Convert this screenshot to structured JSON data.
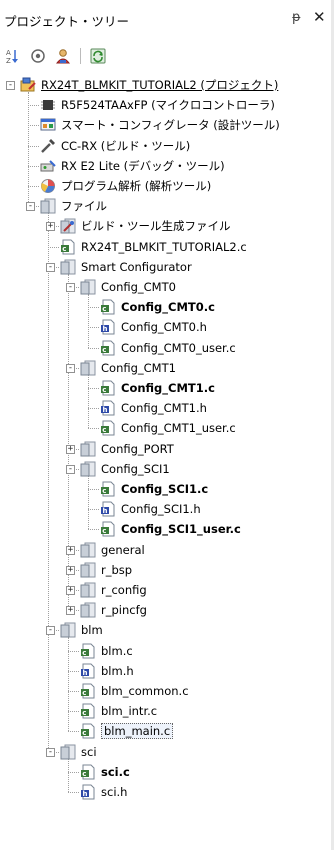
{
  "panel": {
    "title": "プロジェクト・ツリー",
    "pin": "ᵽ",
    "close": "✕"
  },
  "toolbar": {
    "buttons": [
      "sort",
      "filter",
      "properties",
      "refresh"
    ]
  },
  "colors": {
    "folder": "#c8cfd8",
    "file_c": "#3a7a3a",
    "file_h": "#2e4aa8",
    "selection": "#eef3fb"
  },
  "tree": [
    {
      "label": "RX24T_BLMKIT_TUTORIAL2 (プロジェクト)",
      "icon": "project-icon"
    },
    {
      "label": "R5F524TAAxFP (マイクロコントローラ)",
      "icon": "chip-icon"
    },
    {
      "label": "スマート・コンフィグレータ (設計ツール)",
      "icon": "configurator-icon"
    },
    {
      "label": "CC-RX (ビルド・ツール)",
      "icon": "build-tool-icon"
    },
    {
      "label": "RX E2 Lite (デバッグ・ツール)",
      "icon": "debugger-icon"
    },
    {
      "label": "プログラム解析 (解析ツール)",
      "icon": "analysis-icon"
    },
    {
      "label": "ファイル",
      "icon": "folder-icon"
    },
    {
      "label": "ビルド・ツール生成ファイル",
      "icon": "build-folder-icon"
    },
    {
      "label": "RX24T_BLMKIT_TUTORIAL2.c",
      "icon": "c-file-icon"
    },
    {
      "label": "Smart Configurator",
      "icon": "folder-icon"
    },
    {
      "label": "Config_CMT0",
      "icon": "folder-icon"
    },
    {
      "label": "Config_CMT0.c",
      "icon": "c-file-icon"
    },
    {
      "label": "Config_CMT0.h",
      "icon": "h-file-icon"
    },
    {
      "label": "Config_CMT0_user.c",
      "icon": "c-file-icon"
    },
    {
      "label": "Config_CMT1",
      "icon": "folder-icon"
    },
    {
      "label": "Config_CMT1.c",
      "icon": "c-file-icon"
    },
    {
      "label": "Config_CMT1.h",
      "icon": "h-file-icon"
    },
    {
      "label": "Config_CMT1_user.c",
      "icon": "c-file-icon"
    },
    {
      "label": "Config_PORT",
      "icon": "folder-icon"
    },
    {
      "label": "Config_SCI1",
      "icon": "folder-icon"
    },
    {
      "label": "Config_SCI1.c",
      "icon": "c-file-icon"
    },
    {
      "label": "Config_SCI1.h",
      "icon": "h-file-icon"
    },
    {
      "label": "Config_SCI1_user.c",
      "icon": "c-file-icon"
    },
    {
      "label": "general",
      "icon": "folder-icon"
    },
    {
      "label": "r_bsp",
      "icon": "folder-icon"
    },
    {
      "label": "r_config",
      "icon": "folder-icon"
    },
    {
      "label": "r_pincfg",
      "icon": "folder-icon"
    },
    {
      "label": "blm",
      "icon": "folder-icon"
    },
    {
      "label": "blm.c",
      "icon": "c-file-icon"
    },
    {
      "label": "blm.h",
      "icon": "h-file-icon"
    },
    {
      "label": "blm_common.c",
      "icon": "c-file-icon"
    },
    {
      "label": "blm_intr.c",
      "icon": "c-file-icon"
    },
    {
      "label": "blm_main.c",
      "icon": "c-file-icon"
    },
    {
      "label": "sci",
      "icon": "folder-icon"
    },
    {
      "label": "sci.c",
      "icon": "c-file-icon"
    },
    {
      "label": "sci.h",
      "icon": "h-file-icon"
    }
  ]
}
